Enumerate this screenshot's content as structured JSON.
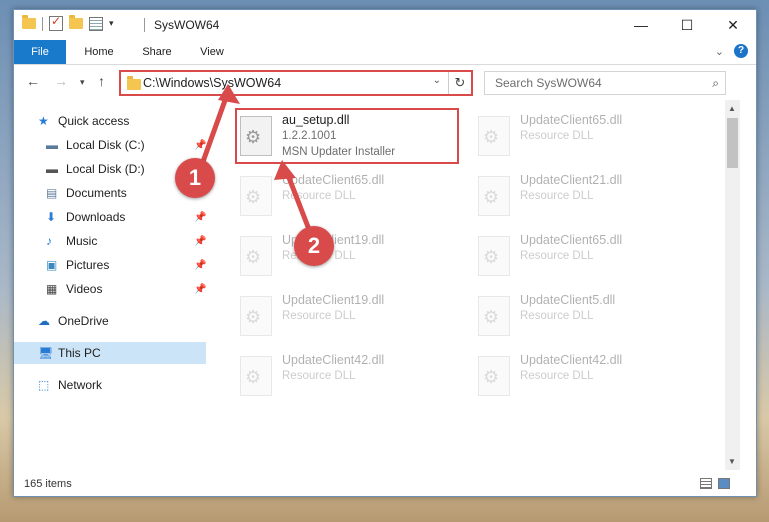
{
  "window": {
    "title": "SysWOW64"
  },
  "ribbon": {
    "tabs": [
      "File",
      "Home",
      "Share",
      "View"
    ]
  },
  "address": {
    "path": "C:\\Windows\\SysWOW64"
  },
  "search": {
    "placeholder": "Search SysWOW64"
  },
  "nav": {
    "items": [
      {
        "label": "Quick access",
        "icon": "star-icon"
      },
      {
        "label": "Local Disk (C:)",
        "icon": "drive-icon"
      },
      {
        "label": "Local Disk (D:)",
        "icon": "drive-icon"
      },
      {
        "label": "Documents",
        "icon": "documents-icon"
      },
      {
        "label": "Downloads",
        "icon": "download-icon"
      },
      {
        "label": "Music",
        "icon": "music-icon"
      },
      {
        "label": "Pictures",
        "icon": "pictures-icon"
      },
      {
        "label": "Videos",
        "icon": "videos-icon"
      },
      {
        "label": "OneDrive",
        "icon": "cloud-icon"
      },
      {
        "label": "This PC",
        "icon": "computer-icon"
      },
      {
        "label": "Network",
        "icon": "network-icon"
      }
    ]
  },
  "files": {
    "main": {
      "name": "au_setup.dll",
      "version": "1.2.2.1001",
      "description": "MSN Updater Installer"
    },
    "left": [
      {
        "name": "UpdateClient65.dll",
        "type": "Resource DLL"
      },
      {
        "name": "UpdateClient19.dll",
        "type": "Resource DLL"
      },
      {
        "name": "UpdateClient19.dll",
        "type": "Resource DLL"
      },
      {
        "name": "UpdateClient42.dll",
        "type": "Resource DLL"
      }
    ],
    "right": [
      {
        "name": "UpdateClient65.dll",
        "type": "Resource DLL"
      },
      {
        "name": "UpdateClient21.dll",
        "type": "Resource DLL"
      },
      {
        "name": "UpdateClient65.dll",
        "type": "Resource DLL"
      },
      {
        "name": "UpdateClient5.dll",
        "type": "Resource DLL"
      },
      {
        "name": "UpdateClient42.dll",
        "type": "Resource DLL"
      }
    ]
  },
  "status": {
    "items_count": "165 items"
  },
  "annotations": {
    "step1": "1",
    "step2": "2",
    "color": "#d94a4a"
  }
}
